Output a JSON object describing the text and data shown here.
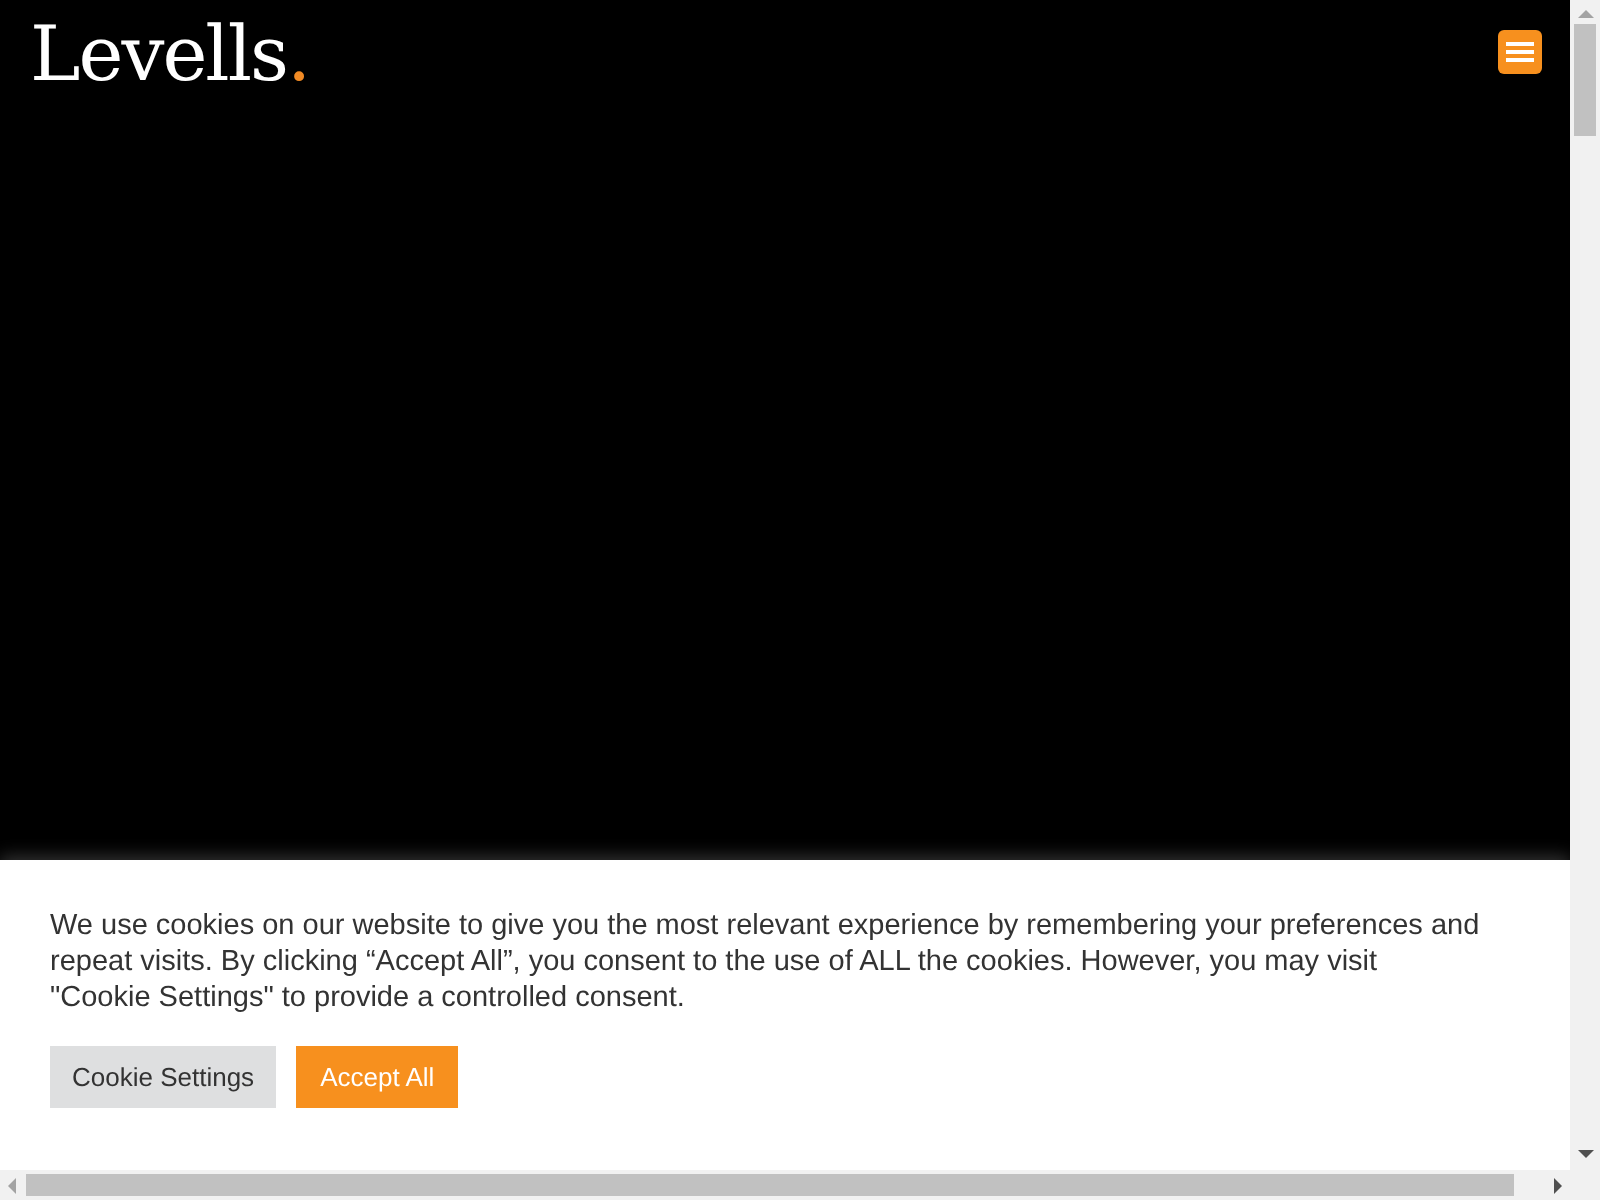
{
  "header": {
    "logo": {
      "text": "Levells",
      "dot": "."
    }
  },
  "cookie_banner": {
    "message": "We use cookies on our website to give you the most relevant experience by remembering your preferences and repeat visits. By clicking “Accept All”, you consent to the use of ALL the cookies. However, you may visit \"Cookie Settings\" to provide a controlled consent.",
    "buttons": [
      {
        "label": "Cookie Settings",
        "kind": "secondary"
      },
      {
        "label": "Accept All",
        "kind": "primary"
      }
    ]
  }
}
